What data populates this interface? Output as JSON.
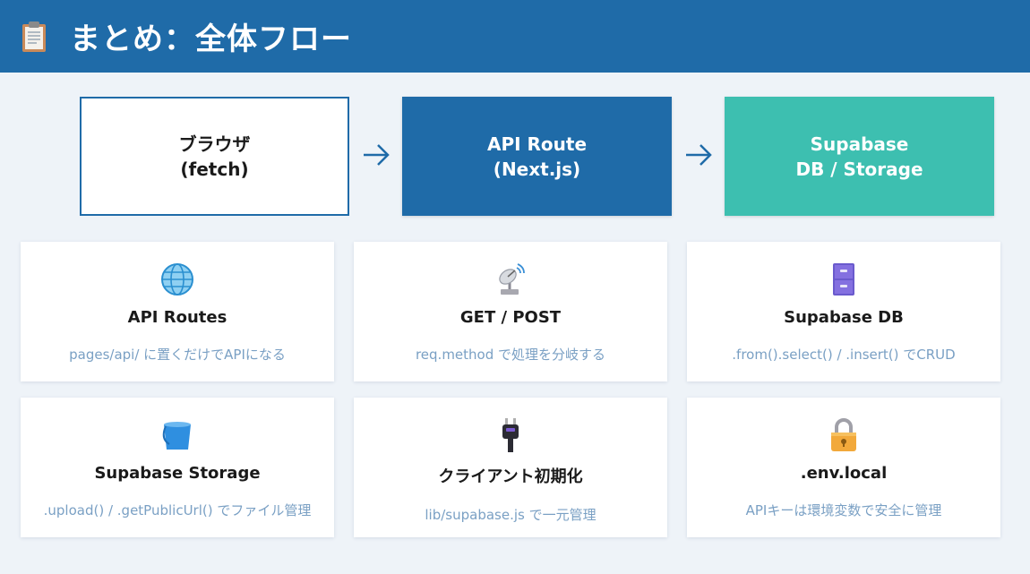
{
  "header": {
    "icon": "clipboard-icon",
    "title": "まとめ：全体フロー"
  },
  "flow": [
    {
      "line1": "ブラウザ",
      "line2": "(fetch)"
    },
    {
      "line1": "API Route",
      "line2": "(Next.js)"
    },
    {
      "line1": "Supabase",
      "line2": "DB / Storage"
    }
  ],
  "colors": {
    "header": "#1f6ba8",
    "api_box": "#1f6ba8",
    "supabase_box": "#3dbfb0",
    "desc_text": "#7aa0c4"
  },
  "cards": [
    {
      "icon": "globe-icon",
      "title": "API Routes",
      "desc": "pages/api/ に置くだけでAPIになる"
    },
    {
      "icon": "satellite-antenna-icon",
      "title": "GET / POST",
      "desc": "req.method で処理を分岐する"
    },
    {
      "icon": "file-cabinet-icon",
      "title": "Supabase DB",
      "desc": ".from().select() / .insert() でCRUD"
    },
    {
      "icon": "bucket-icon",
      "title": "Supabase Storage",
      "desc": ".upload() / .getPublicUrl() でファイル管理"
    },
    {
      "icon": "electric-plug-icon",
      "title": "クライアント初期化",
      "desc": "lib/supabase.js で一元管理"
    },
    {
      "icon": "lock-icon",
      "title": ".env.local",
      "desc": "APIキーは環境変数で安全に管理"
    }
  ]
}
